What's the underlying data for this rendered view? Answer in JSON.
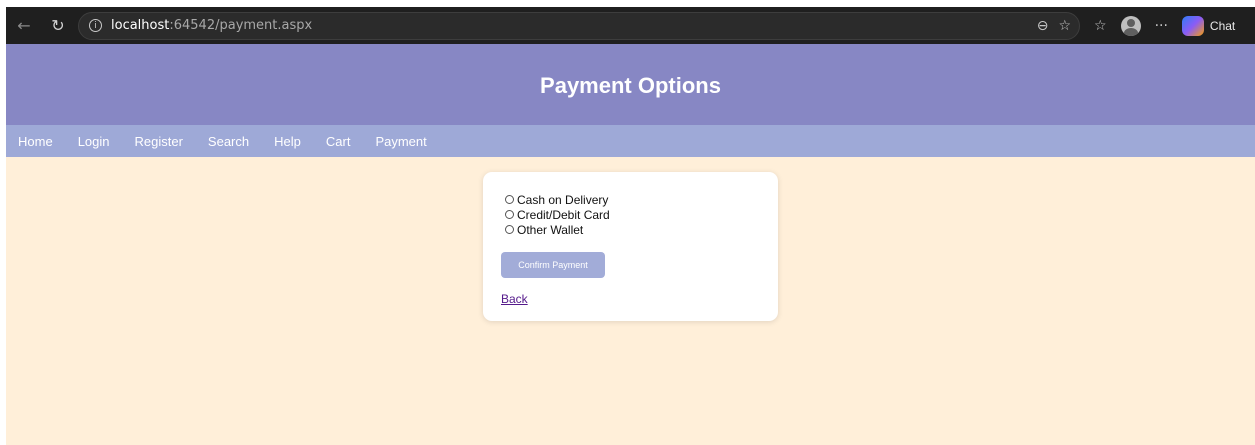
{
  "browser": {
    "url_host": "localhost",
    "url_rest": ":64542/payment.aspx",
    "chat_label": "Chat"
  },
  "header": {
    "title": "Payment Options"
  },
  "nav": {
    "items": [
      "Home",
      "Login",
      "Register",
      "Search",
      "Help",
      "Cart",
      "Payment"
    ]
  },
  "payment": {
    "options": [
      "Cash on Delivery",
      "Credit/Debit Card",
      "Other Wallet"
    ],
    "confirm_label": "Confirm Payment",
    "back_label": "Back"
  },
  "colors": {
    "header_bg": "#8787c4",
    "menu_bg": "#9ea9d7",
    "page_bg": "#ffefd9",
    "button_bg": "#a2acd8"
  }
}
